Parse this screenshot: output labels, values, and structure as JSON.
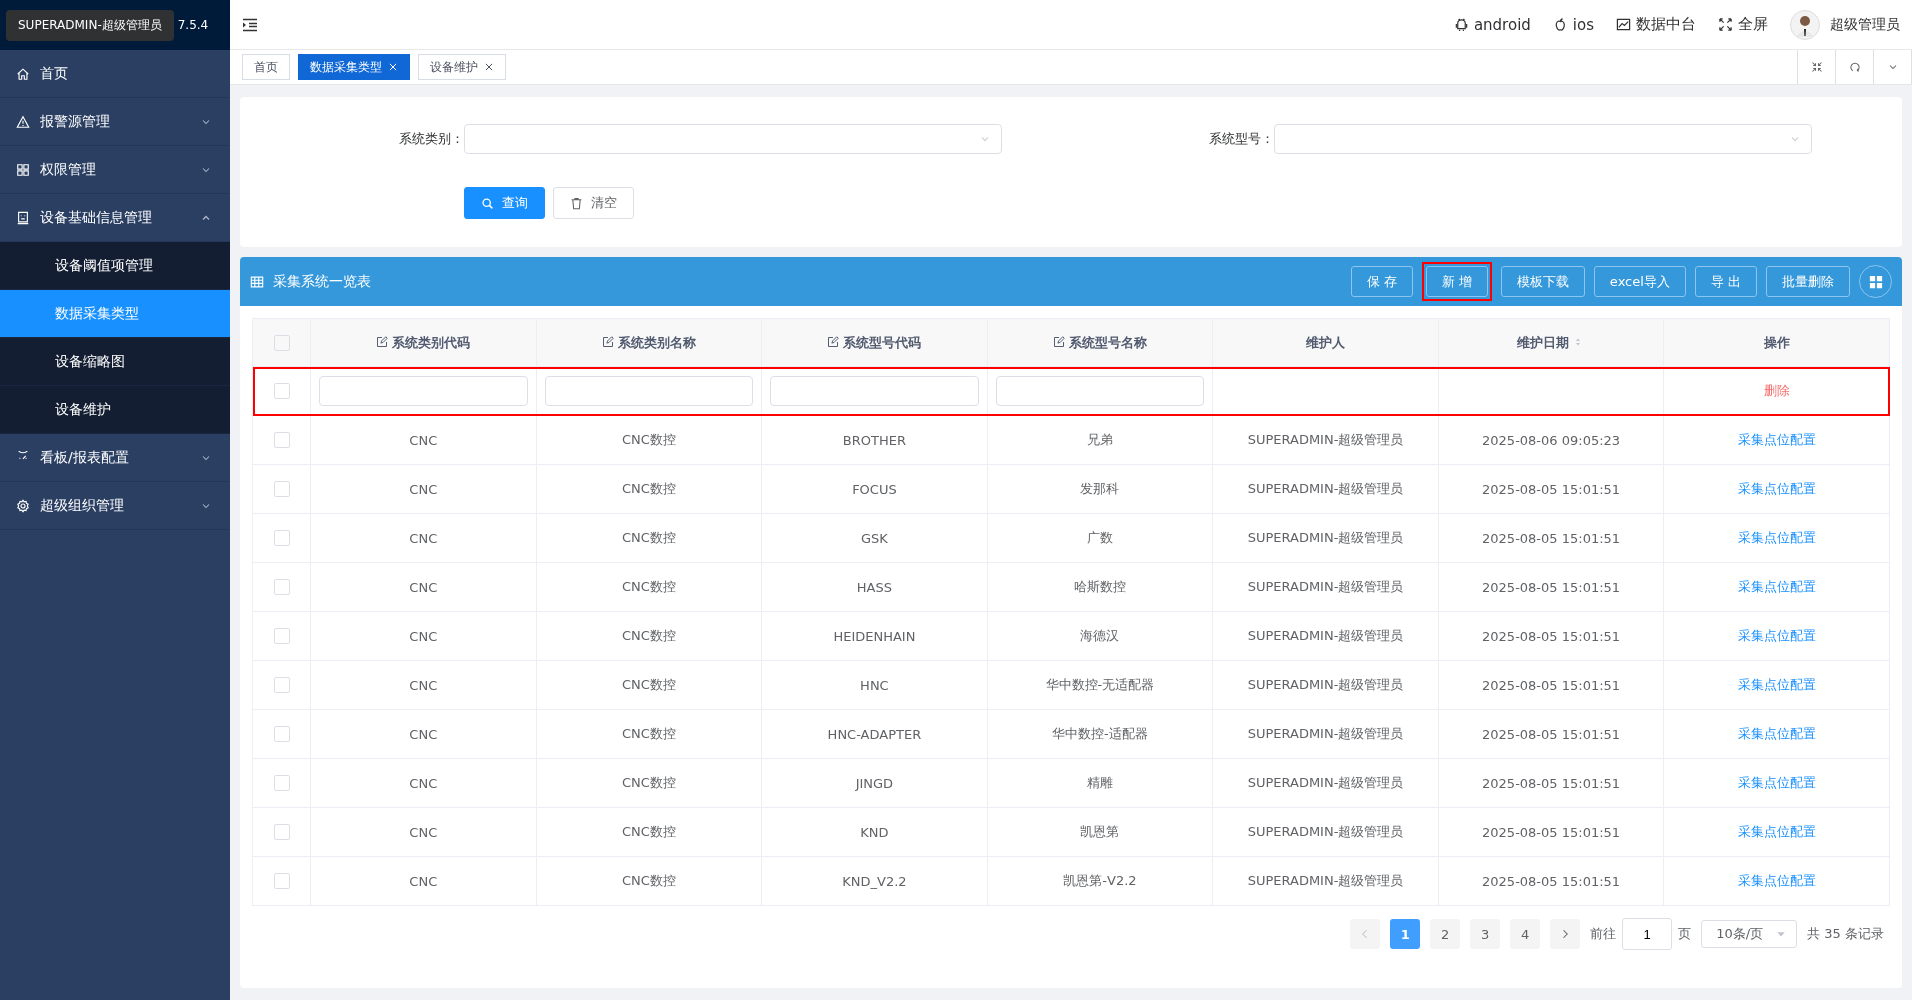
{
  "sidebar": {
    "tooltip": "SUPERADMIN-超级管理员",
    "version": "7.5.4",
    "items": [
      {
        "label": "首页",
        "selected": false
      },
      {
        "label": "报警源管理",
        "expanded": false,
        "selected": false
      },
      {
        "label": "权限管理",
        "expanded": false,
        "selected": false
      },
      {
        "label": "设备基础信息管理",
        "expanded": true,
        "selected": false,
        "children": [
          {
            "label": "设备阈值项管理",
            "selected": false
          },
          {
            "label": "数据采集类型",
            "selected": true
          },
          {
            "label": "设备缩略图",
            "selected": false
          },
          {
            "label": "设备维护",
            "selected": false
          }
        ]
      },
      {
        "label": "看板/报表配置",
        "expanded": false,
        "selected": false
      },
      {
        "label": "超级组织管理",
        "expanded": false,
        "selected": false
      }
    ]
  },
  "header": {
    "links": [
      {
        "label": "android"
      },
      {
        "label": "ios"
      },
      {
        "label": "数据中台"
      },
      {
        "label": "全屏"
      }
    ],
    "user": "超级管理员"
  },
  "tabs": [
    {
      "label": "首页",
      "selected": false,
      "closable": false
    },
    {
      "label": "数据采集类型",
      "selected": true,
      "closable": true
    },
    {
      "label": "设备维护",
      "selected": false,
      "closable": true
    }
  ],
  "filters": [
    {
      "label": "系统类别："
    },
    {
      "label": "系统型号："
    }
  ],
  "filter_buttons": [
    {
      "label": "查询",
      "kind": "primary"
    },
    {
      "label": "清空",
      "kind": "plain"
    }
  ],
  "panel": {
    "title": "采集系统一览表",
    "buttons": [
      {
        "label": "保 存",
        "highlighted": false
      },
      {
        "label": "新 增",
        "highlighted": true
      },
      {
        "label": "模板下载",
        "highlighted": false
      },
      {
        "label": "excel导入",
        "highlighted": false
      },
      {
        "label": "导 出",
        "highlighted": false
      },
      {
        "label": "批量删除",
        "highlighted": false
      }
    ]
  },
  "table": {
    "all_checked": false,
    "columns": [
      {
        "label": "系统类别代码",
        "editable": true,
        "sortable": false
      },
      {
        "label": "系统类别名称",
        "editable": true,
        "sortable": false
      },
      {
        "label": "系统型号代码",
        "editable": true,
        "sortable": false
      },
      {
        "label": "系统型号名称",
        "editable": true,
        "sortable": false
      },
      {
        "label": "维护人",
        "editable": false,
        "sortable": false
      },
      {
        "label": "维护日期",
        "editable": false,
        "sortable": true
      },
      {
        "label": "操作",
        "editable": false,
        "sortable": false
      }
    ],
    "new_row": {
      "highlighted": true,
      "checked": false,
      "action": "删除"
    },
    "rows": [
      {
        "checked": false,
        "cells": [
          "CNC",
          "CNC数控",
          "BROTHER",
          "兄弟",
          "SUPERADMIN-超级管理员",
          "2025-08-06 09:05:23"
        ],
        "action": "采集点位配置"
      },
      {
        "checked": false,
        "cells": [
          "CNC",
          "CNC数控",
          "FOCUS",
          "发那科",
          "SUPERADMIN-超级管理员",
          "2025-08-05 15:01:51"
        ],
        "action": "采集点位配置"
      },
      {
        "checked": false,
        "cells": [
          "CNC",
          "CNC数控",
          "GSK",
          "广数",
          "SUPERADMIN-超级管理员",
          "2025-08-05 15:01:51"
        ],
        "action": "采集点位配置"
      },
      {
        "checked": false,
        "cells": [
          "CNC",
          "CNC数控",
          "HASS",
          "哈斯数控",
          "SUPERADMIN-超级管理员",
          "2025-08-05 15:01:51"
        ],
        "action": "采集点位配置"
      },
      {
        "checked": false,
        "cells": [
          "CNC",
          "CNC数控",
          "HEIDENHAIN",
          "海德汉",
          "SUPERADMIN-超级管理员",
          "2025-08-05 15:01:51"
        ],
        "action": "采集点位配置"
      },
      {
        "checked": false,
        "cells": [
          "CNC",
          "CNC数控",
          "HNC",
          "华中数控-无适配器",
          "SUPERADMIN-超级管理员",
          "2025-08-05 15:01:51"
        ],
        "action": "采集点位配置"
      },
      {
        "checked": false,
        "cells": [
          "CNC",
          "CNC数控",
          "HNC-ADAPTER",
          "华中数控-适配器",
          "SUPERADMIN-超级管理员",
          "2025-08-05 15:01:51"
        ],
        "action": "采集点位配置"
      },
      {
        "checked": false,
        "cells": [
          "CNC",
          "CNC数控",
          "JINGD",
          "精雕",
          "SUPERADMIN-超级管理员",
          "2025-08-05 15:01:51"
        ],
        "action": "采集点位配置"
      },
      {
        "checked": false,
        "cells": [
          "CNC",
          "CNC数控",
          "KND",
          "凯恩第",
          "SUPERADMIN-超级管理员",
          "2025-08-05 15:01:51"
        ],
        "action": "采集点位配置"
      },
      {
        "checked": false,
        "cells": [
          "CNC",
          "CNC数控",
          "KND_V2.2",
          "凯恩第-V2.2",
          "SUPERADMIN-超级管理员",
          "2025-08-05 15:01:51"
        ],
        "action": "采集点位配置"
      }
    ]
  },
  "pagination": {
    "pages": [
      {
        "label": "1",
        "selected": true
      },
      {
        "label": "2",
        "selected": false
      },
      {
        "label": "3",
        "selected": false
      },
      {
        "label": "4",
        "selected": false
      }
    ],
    "goto_label": "前往",
    "goto_value": "1",
    "page_unit": "页",
    "page_size": "10条/页",
    "total": "共 35 条记录"
  }
}
